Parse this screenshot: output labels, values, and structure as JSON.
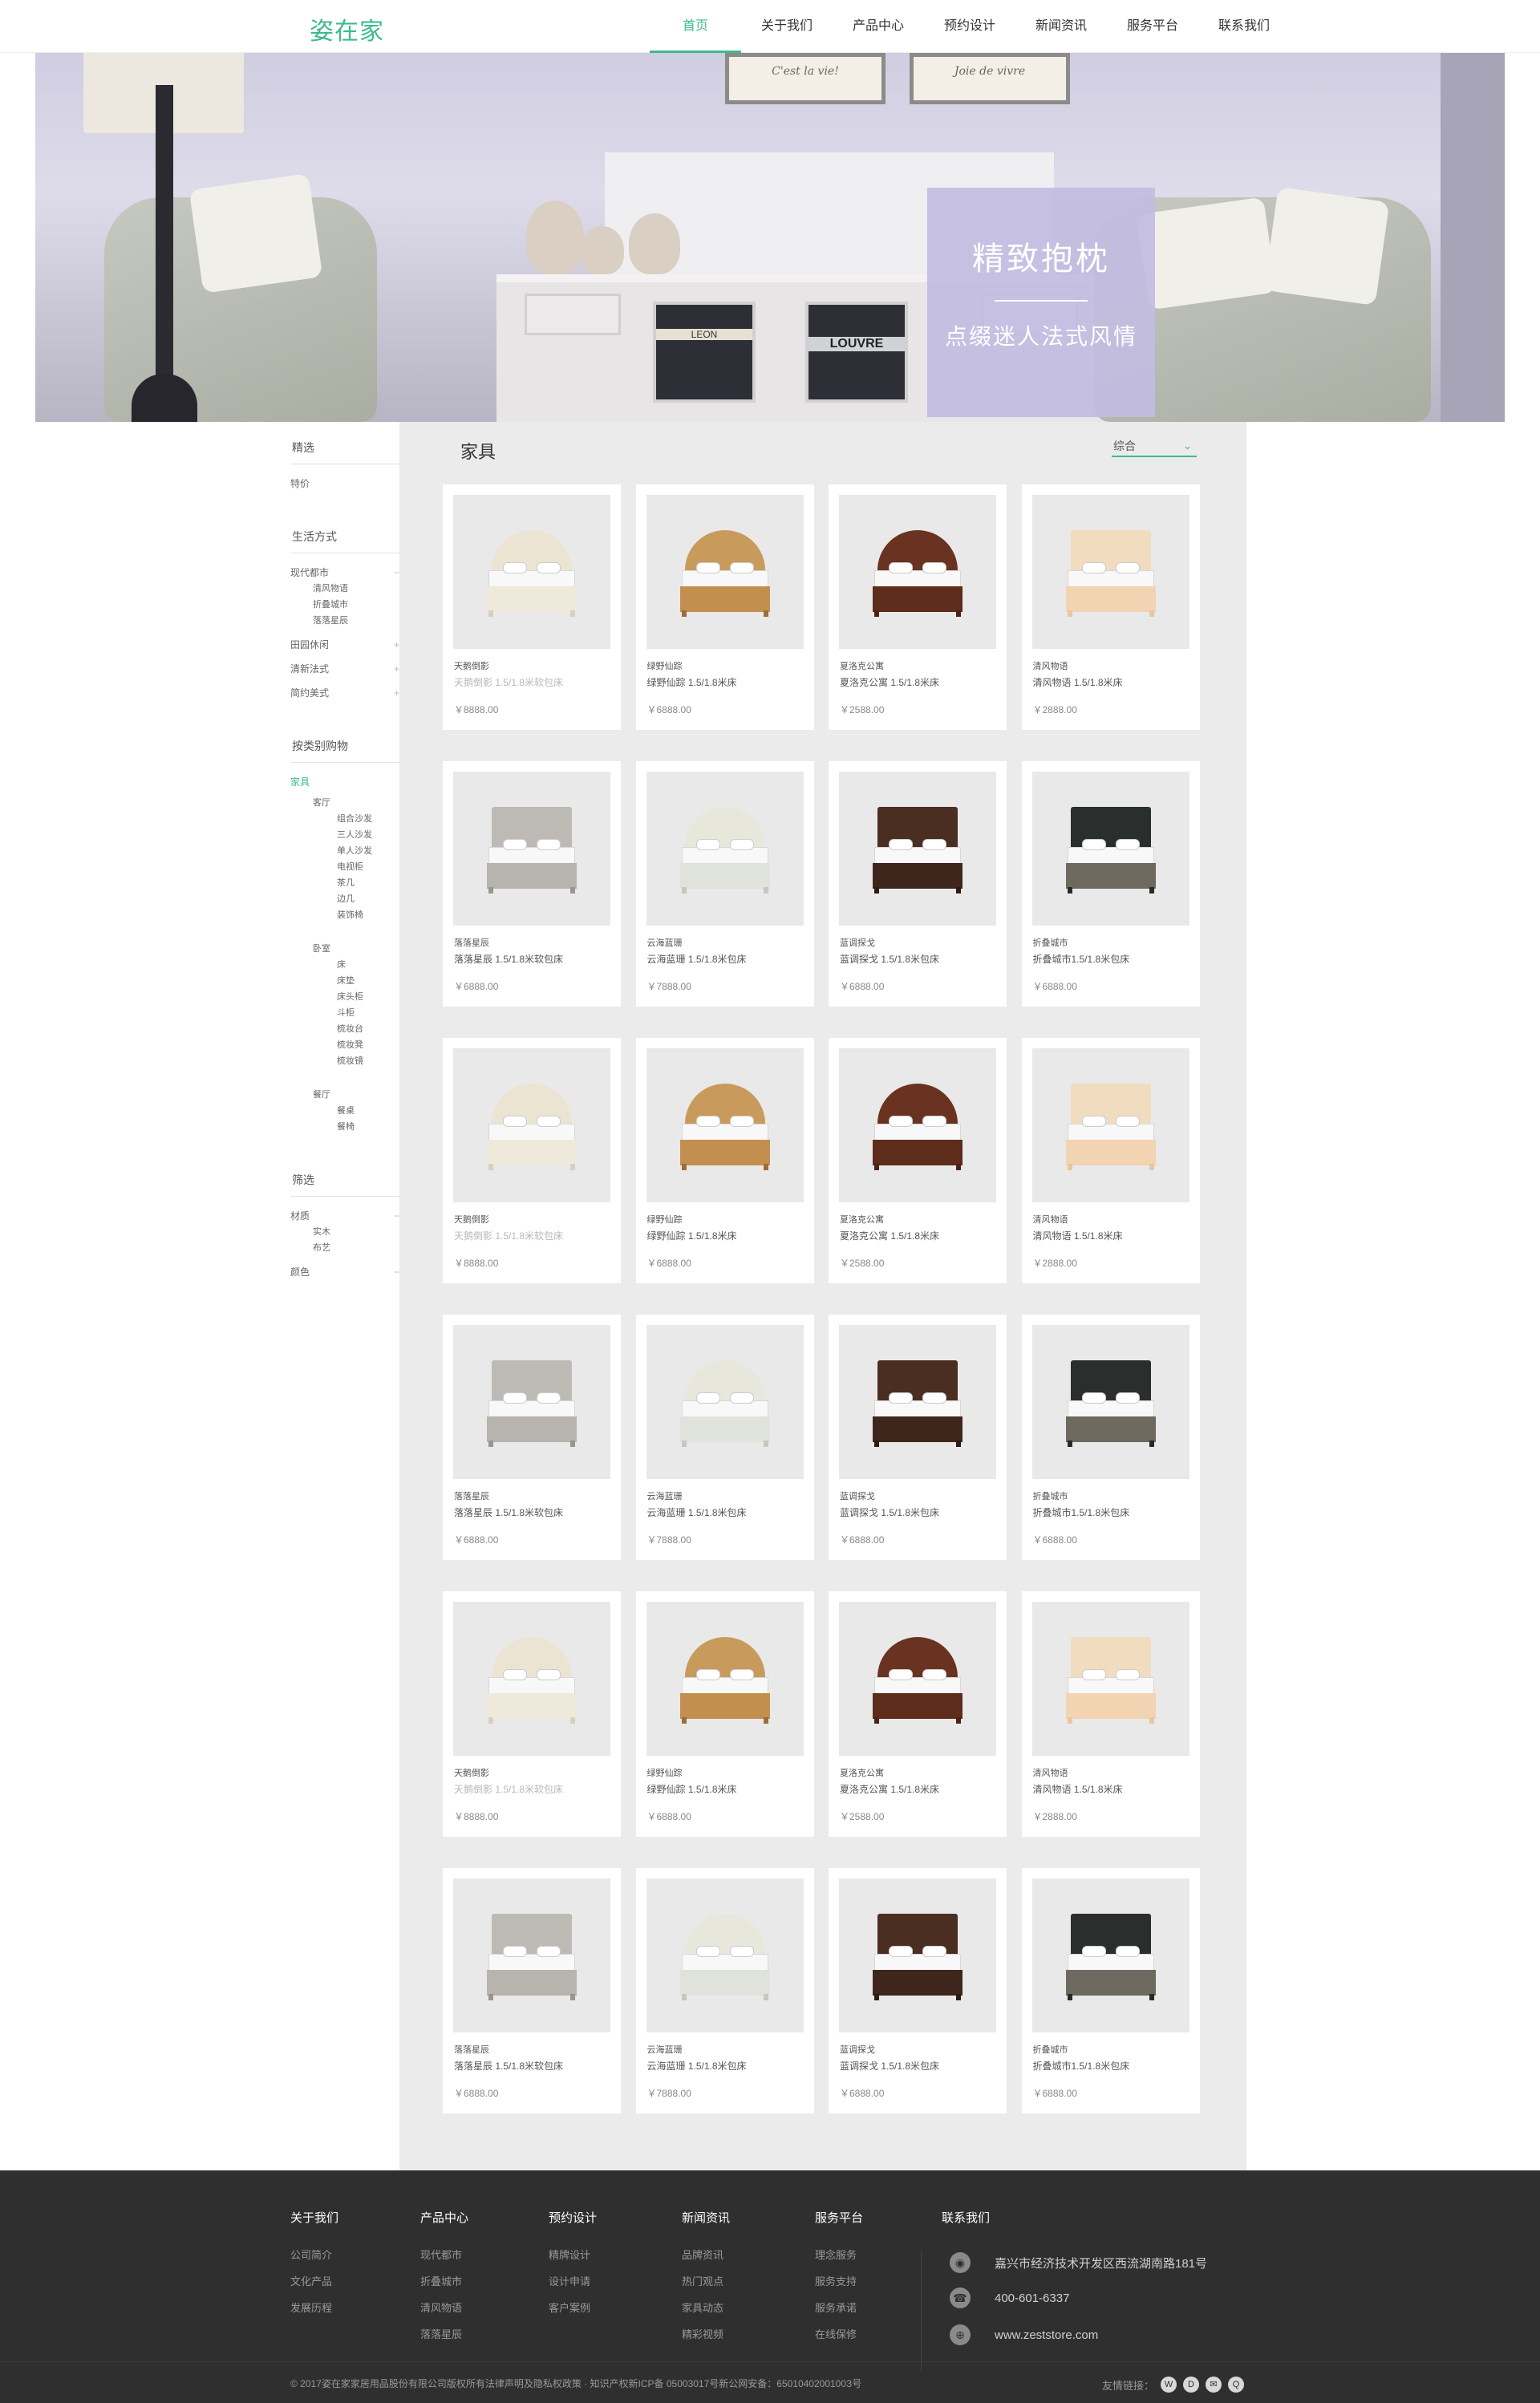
{
  "header": {
    "logo": "姿在家",
    "nav": [
      {
        "label": "首页",
        "active": true
      },
      {
        "label": "关于我们"
      },
      {
        "label": "产品中心"
      },
      {
        "label": "预约设计"
      },
      {
        "label": "新闻资讯"
      },
      {
        "label": "服务平台"
      },
      {
        "label": "联系我们"
      }
    ]
  },
  "banner": {
    "title": "精致抱枕",
    "subtitle": "点缀迷人法式风情",
    "frame_texts": [
      "C'est la vie!",
      "Joie de vivre"
    ],
    "sign_texts": [
      "LEON",
      "LOUVRE"
    ]
  },
  "sidebar": {
    "groups": [
      {
        "title": "精选",
        "items": [
          {
            "label": "特价",
            "level": 1
          }
        ]
      },
      {
        "title": "生活方式",
        "items": [
          {
            "label": "现代都市",
            "level": 1,
            "toggle": "−"
          },
          {
            "label": "清风物语",
            "level": 2
          },
          {
            "label": "折叠城市",
            "level": 2
          },
          {
            "label": "落落星辰",
            "level": 2
          },
          {
            "label": "田园休闲",
            "level": 1,
            "toggle": "+"
          },
          {
            "label": "清新法式",
            "level": 1,
            "toggle": "+"
          },
          {
            "label": "简约美式",
            "level": 1,
            "toggle": "+"
          }
        ]
      },
      {
        "title": "按类别购物",
        "items": [
          {
            "label": "家具",
            "level": 1,
            "active": true
          },
          {
            "label": "客厅",
            "level": 2
          },
          {
            "label": "组合沙发",
            "level": 3
          },
          {
            "label": "三人沙发",
            "level": 3
          },
          {
            "label": "单人沙发",
            "level": 3
          },
          {
            "label": "电视柜",
            "level": 3
          },
          {
            "label": "茶几",
            "level": 3
          },
          {
            "label": "边几",
            "level": 3
          },
          {
            "label": "装饰椅",
            "level": 3
          },
          {
            "label": "",
            "level": 0
          },
          {
            "label": "卧室",
            "level": 2
          },
          {
            "label": "床",
            "level": 3
          },
          {
            "label": "床垫",
            "level": 3
          },
          {
            "label": "床头柜",
            "level": 3
          },
          {
            "label": "斗柜",
            "level": 3
          },
          {
            "label": "梳妆台",
            "level": 3
          },
          {
            "label": "梳妆凳",
            "level": 3
          },
          {
            "label": "梳妆镜",
            "level": 3
          },
          {
            "label": "",
            "level": 0
          },
          {
            "label": "餐厅",
            "level": 2
          },
          {
            "label": "餐桌",
            "level": 3
          },
          {
            "label": "餐椅",
            "level": 3
          }
        ]
      },
      {
        "title": "筛选",
        "items": [
          {
            "label": "材质",
            "level": 1,
            "toggle": "−"
          },
          {
            "label": "实木",
            "level": 2
          },
          {
            "label": "布艺",
            "level": 2
          },
          {
            "label": "颜色",
            "level": 1,
            "toggle": "−"
          }
        ]
      }
    ]
  },
  "main": {
    "title": "家具",
    "sort_label": "综合",
    "products": [
      {
        "brand": "天鹅倒影",
        "name": "天鹅倒影 1.5/1.8米软包床",
        "price": "￥8888.00",
        "style": "cream",
        "faded": true
      },
      {
        "brand": "绿野仙踪",
        "name": "绿野仙踪 1.5/1.8米床",
        "price": "￥6888.00",
        "style": "oak"
      },
      {
        "brand": "夏洛克公寓",
        "name": "夏洛克公寓 1.5/1.8米床",
        "price": "￥2588.00",
        "style": "walnut"
      },
      {
        "brand": "清风物语",
        "name": "清风物语 1.5/1.8米床",
        "price": "￥2888.00",
        "style": "peach"
      },
      {
        "brand": "落落星辰",
        "name": "落落星辰 1.5/1.8米软包床",
        "price": "￥6888.00",
        "style": "grey"
      },
      {
        "brand": "云海蓝珊",
        "name": "云海蓝珊 1.5/1.8米包床",
        "price": "￥7888.00",
        "style": "ivory"
      },
      {
        "brand": "蓝调探戈",
        "name": "蓝调探戈 1.5/1.8米包床",
        "price": "￥6888.00",
        "style": "dark"
      },
      {
        "brand": "折叠城市",
        "name": "折叠城市1.5/1.8米包床",
        "price": "￥6888.00",
        "style": "black"
      },
      {
        "brand": "天鹅倒影",
        "name": "天鹅倒影 1.5/1.8米软包床",
        "price": "￥8888.00",
        "style": "cream",
        "faded": true
      },
      {
        "brand": "绿野仙踪",
        "name": "绿野仙踪 1.5/1.8米床",
        "price": "￥6888.00",
        "style": "oak"
      },
      {
        "brand": "夏洛克公寓",
        "name": "夏洛克公寓 1.5/1.8米床",
        "price": "￥2588.00",
        "style": "walnut"
      },
      {
        "brand": "清风物语",
        "name": "清风物语 1.5/1.8米床",
        "price": "￥2888.00",
        "style": "peach"
      },
      {
        "brand": "落落星辰",
        "name": "落落星辰 1.5/1.8米软包床",
        "price": "￥6888.00",
        "style": "grey"
      },
      {
        "brand": "云海蓝珊",
        "name": "云海蓝珊 1.5/1.8米包床",
        "price": "￥7888.00",
        "style": "ivory"
      },
      {
        "brand": "蓝调探戈",
        "name": "蓝调探戈 1.5/1.8米包床",
        "price": "￥6888.00",
        "style": "dark"
      },
      {
        "brand": "折叠城市",
        "name": "折叠城市1.5/1.8米包床",
        "price": "￥6888.00",
        "style": "black"
      },
      {
        "brand": "天鹅倒影",
        "name": "天鹅倒影 1.5/1.8米软包床",
        "price": "￥8888.00",
        "style": "cream",
        "faded": true
      },
      {
        "brand": "绿野仙踪",
        "name": "绿野仙踪 1.5/1.8米床",
        "price": "￥6888.00",
        "style": "oak"
      },
      {
        "brand": "夏洛克公寓",
        "name": "夏洛克公寓 1.5/1.8米床",
        "price": "￥2588.00",
        "style": "walnut"
      },
      {
        "brand": "清风物语",
        "name": "清风物语 1.5/1.8米床",
        "price": "￥2888.00",
        "style": "peach"
      },
      {
        "brand": "落落星辰",
        "name": "落落星辰 1.5/1.8米软包床",
        "price": "￥6888.00",
        "style": "grey"
      },
      {
        "brand": "云海蓝珊",
        "name": "云海蓝珊 1.5/1.8米包床",
        "price": "￥7888.00",
        "style": "ivory"
      },
      {
        "brand": "蓝调探戈",
        "name": "蓝调探戈 1.5/1.8米包床",
        "price": "￥6888.00",
        "style": "dark"
      },
      {
        "brand": "折叠城市",
        "name": "折叠城市1.5/1.8米包床",
        "price": "￥6888.00",
        "style": "black"
      }
    ]
  },
  "footer": {
    "columns": [
      {
        "title": "关于我们",
        "links": [
          "公司简介",
          "文化产品",
          "发展历程"
        ]
      },
      {
        "title": "产品中心",
        "links": [
          "现代都市",
          "折叠城市",
          "清风物语",
          "落落星辰"
        ]
      },
      {
        "title": "预约设计",
        "links": [
          "精牌设计",
          "设计申请",
          "客户案例"
        ]
      },
      {
        "title": "新闻资讯",
        "links": [
          "品牌资讯",
          "热门观点",
          "家具动态",
          "精彩视频"
        ]
      },
      {
        "title": "服务平台",
        "links": [
          "理念服务",
          "服务支持",
          "服务承诺",
          "在线保修"
        ]
      }
    ],
    "contact_title": "联系我们",
    "contacts": [
      {
        "icon": "location-icon",
        "text": "嘉兴市经济技术开发区西流湖南路181号"
      },
      {
        "icon": "phone-icon",
        "text": "400-601-6337"
      },
      {
        "icon": "globe-icon",
        "text": "www.zeststore.com"
      }
    ],
    "copyright": "© 2017姿在家家居用品股份有限公司版权所有法律声明及隐私权政策 · 知识产权新ICP备 05003017号新公网安备：6501040200100З号",
    "friend_links_label": "友情链接：",
    "social_icons": [
      "weibo-icon",
      "douban-icon",
      "wechat-icon",
      "qq-icon"
    ],
    "colors": {
      "accent": "#3dbb8a",
      "footer_bg": "#2f2f2f"
    }
  }
}
